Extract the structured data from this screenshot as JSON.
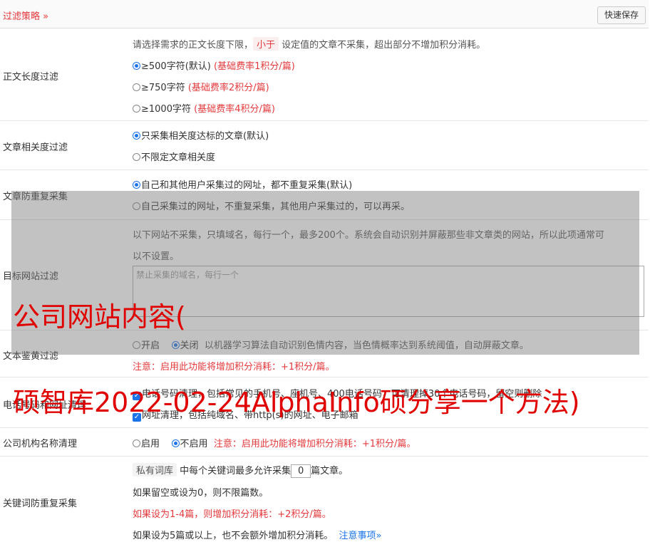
{
  "header": {
    "title": "过滤策略 »",
    "save_label": "快速保存"
  },
  "body_length": {
    "label": "正文长度过滤",
    "desc_pre": "请选择需求的正文长度下限，",
    "desc_tag": "小于",
    "desc_post": "设定值的文章不采集，超出部分不增加积分消耗。",
    "options": [
      {
        "text": "≥500字符(默认)",
        "note": "(基础费率1积分/篇)"
      },
      {
        "text": "≥750字符",
        "note": "(基础费率2积分/篇)"
      },
      {
        "text": "≥1000字符",
        "note": "(基础费率4积分/篇)"
      }
    ]
  },
  "relevance": {
    "label": "文章相关度过滤",
    "options": [
      "只采集相关度达标的文章(默认)",
      "不限定文章相关度"
    ]
  },
  "dedupe": {
    "label": "文章防重复采集",
    "options": [
      "自己和其他用户采集过的网址，都不重复采集(默认)",
      "自己采集过的网址，不重复采集，其他用户采集过的，可以再采。"
    ]
  },
  "target_site": {
    "label": "目标网站过滤",
    "desc_line1": "以下网站不采集，只填域名，每行一个，最多200个。系统会自动识别并屏蔽那些非文章类的网站，所以此项通常可",
    "desc_line2": "以不设置。",
    "placeholder": "禁止采集的域名，每行一个"
  },
  "porn": {
    "label": "文本鉴黄过滤",
    "opt_on": "开启",
    "opt_off": "关闭",
    "desc": "以机器学习算法自动识别色情内容，当色情概率达到系统阈值，自动屏蔽文章。",
    "note": "注意：启用此功能将增加积分消耗：+1积分/篇。"
  },
  "contact": {
    "label": "电话号码和网址清理",
    "phone_line": "电话号码清理，包括常见的手机号、座机号、400电话号码，可清理掉30个电话号码，留空则删除",
    "url_line": "网址清理，包括纯域名、带http(s)的网址、电子邮箱"
  },
  "org": {
    "label": "公司机构名称清理",
    "opt_on": "启用",
    "opt_off": "不启用",
    "note": "注意：启用此功能将增加积分消耗：+1积分/篇。"
  },
  "keyword": {
    "label": "关键词防重复采集",
    "tag": "私有词库",
    "line1_pre": "中每个关键词最多允许采集",
    "line1_value": "0",
    "line1_post": "篇文章。",
    "line2": "如果留空或设为0，则不限篇数。",
    "line3": "如果设为1-4篇，则增加积分消耗：+2积分/篇。",
    "line4": "如果设为5篇或以上，也不会额外增加积分消耗。",
    "link": "注意事项»"
  },
  "watermark": {
    "line1": "公司网站内容(",
    "line2": "硕智库2022-02-24AlphaInfo硕分享一个方法)"
  }
}
